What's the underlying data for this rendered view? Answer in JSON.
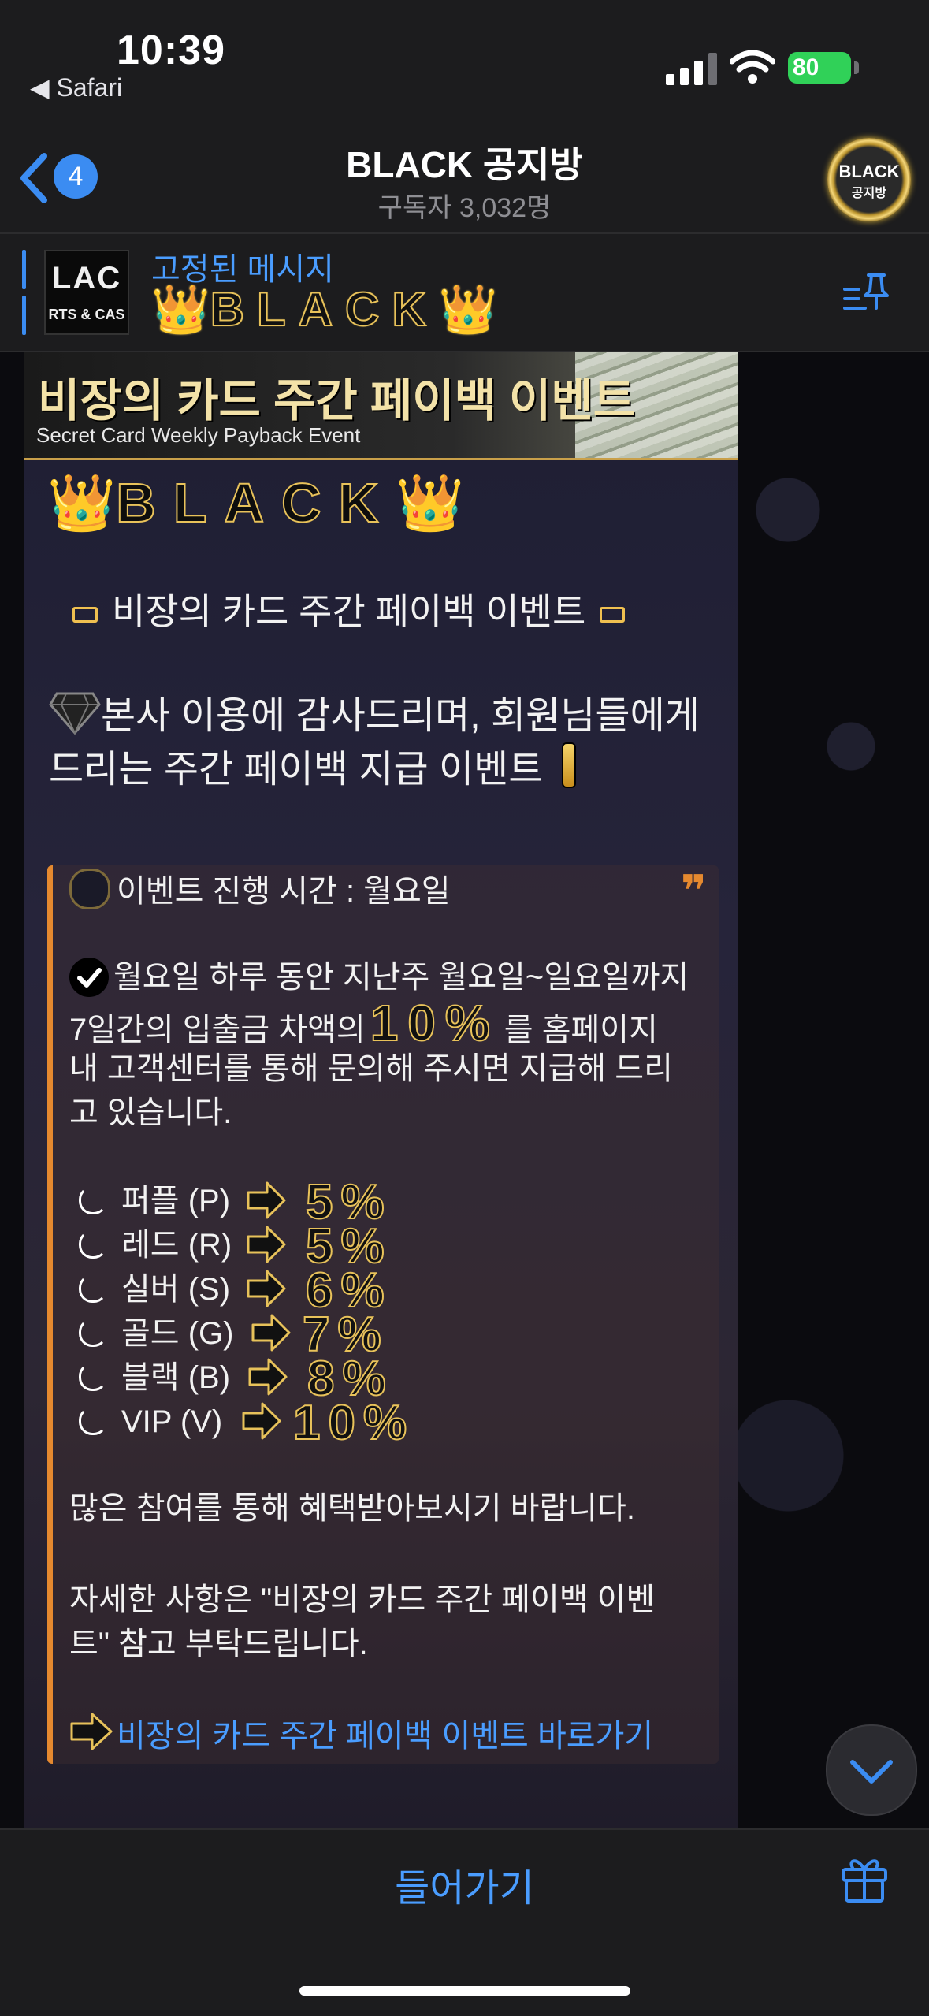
{
  "status_bar": {
    "time": "10:39",
    "back_app": "◀ Safari",
    "battery": "80"
  },
  "header": {
    "back_badge": "4",
    "title": "BLACK 공지방",
    "subtitle": "구독자 3,032명",
    "avatar_line1": "BLACK",
    "avatar_line2": "공지방"
  },
  "pinned": {
    "thumb_line1": "LAC",
    "thumb_line2": "RTS & CAS",
    "label": "고정된 메시지",
    "text": "BLACK",
    "crown": "👑"
  },
  "message": {
    "banner_title": "비장의 카드 주간 페이백 이벤트",
    "banner_subtitle": "Secret Card Weekly Payback Event",
    "brand": "BLACK",
    "crown": "👑",
    "headline": "비장의 카드 주간 페이백 이벤트",
    "intro": "본사 이용에 감사드리며, 회원님들에게 드리는 주간 페이백 지급 이벤트",
    "quote_mark": "❞",
    "event_time": "이벤트 진행 시간 : 월요일",
    "desc_line1": "월요일 하루 동안 지난주 월요일~일요일까지",
    "desc_line2_pre": "7일간의 입출금 차액의",
    "desc_pct": "10%",
    "desc_line2_post": "를 홈페이지",
    "desc_line3": "내 고객센터를 통해 문의해 주시면 지급해 드리",
    "desc_line4": "고 있습니다.",
    "tiers": [
      {
        "name": "퍼플 (P)",
        "pct": "5%"
      },
      {
        "name": "레드 (R)",
        "pct": "5%"
      },
      {
        "name": "실버 (S)",
        "pct": "6%"
      },
      {
        "name": "골드 (G)",
        "pct": "7%"
      },
      {
        "name": "블랙 (B)",
        "pct": "8%"
      },
      {
        "name": "VIP (V)",
        "pct": "10%"
      }
    ],
    "closing": "많은 참여를 통해 혜택받아보시기 바랍니다.",
    "detail_line1": "자세한 사항은 \"비장의 카드 주간 페이백 이벤",
    "detail_line2": "트\" 참고 부탁드립니다.",
    "link": "비장의 카드 주간 페이백 이벤트 바로가기"
  },
  "bottom": {
    "join_label": "들어가기"
  }
}
